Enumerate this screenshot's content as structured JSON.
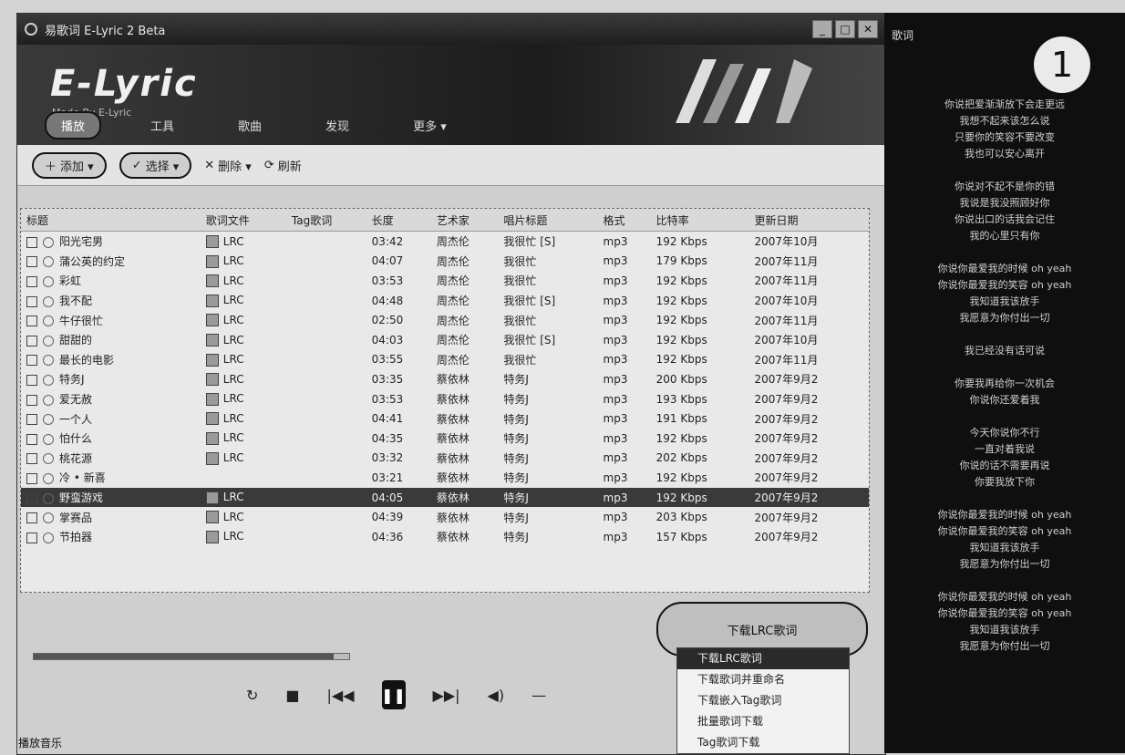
{
  "window": {
    "title": "易歌词 E-Lyric 2 Beta",
    "buttons": [
      "_",
      "□",
      "✕"
    ]
  },
  "banner": {
    "logo": "E-Lyric",
    "subtitle": "Made By E-Lyric"
  },
  "tabs": [
    {
      "label": "播放"
    },
    {
      "label": "工具"
    },
    {
      "label": "歌曲"
    },
    {
      "label": "发现"
    },
    {
      "label": "更多 ▾"
    }
  ],
  "toolbar": {
    "add": "添加 ▾",
    "select": "选择 ▾",
    "delete": "删除 ▾",
    "refresh": "刷新"
  },
  "table": {
    "columns": [
      "标题",
      "歌词文件",
      "Tag歌词",
      "长度",
      "艺术家",
      "唱片标题",
      "格式",
      "比特率",
      "更新日期"
    ],
    "rows": [
      [
        "阳光宅男",
        "LRC",
        "",
        "03:42",
        "周杰伦",
        "我很忙 [S]",
        "mp3",
        "192 Kbps",
        "2007年10月"
      ],
      [
        "蒲公英的约定",
        "LRC",
        "",
        "04:07",
        "周杰伦",
        "我很忙",
        "mp3",
        "179 Kbps",
        "2007年11月"
      ],
      [
        "彩虹",
        "LRC",
        "",
        "03:53",
        "周杰伦",
        "我很忙",
        "mp3",
        "192 Kbps",
        "2007年11月"
      ],
      [
        "我不配",
        "LRC",
        "",
        "04:48",
        "周杰伦",
        "我很忙 [S]",
        "mp3",
        "192 Kbps",
        "2007年10月"
      ],
      [
        "牛仔很忙",
        "LRC",
        "",
        "02:50",
        "周杰伦",
        "我很忙",
        "mp3",
        "192 Kbps",
        "2007年11月"
      ],
      [
        "甜甜的",
        "LRC",
        "",
        "04:03",
        "周杰伦",
        "我很忙 [S]",
        "mp3",
        "192 Kbps",
        "2007年10月"
      ],
      [
        "最长的电影",
        "LRC",
        "",
        "03:55",
        "周杰伦",
        "我很忙",
        "mp3",
        "192 Kbps",
        "2007年11月"
      ],
      [
        "特务J",
        "LRC",
        "",
        "03:35",
        "蔡依林",
        "特务J",
        "mp3",
        "200 Kbps",
        "2007年9月2"
      ],
      [
        "爱无赦",
        "LRC",
        "",
        "03:53",
        "蔡依林",
        "特务J",
        "mp3",
        "193 Kbps",
        "2007年9月2"
      ],
      [
        "一个人",
        "LRC",
        "",
        "04:41",
        "蔡依林",
        "特务J",
        "mp3",
        "191 Kbps",
        "2007年9月2"
      ],
      [
        "怕什么",
        "LRC",
        "",
        "04:35",
        "蔡依林",
        "特务J",
        "mp3",
        "192 Kbps",
        "2007年9月2"
      ],
      [
        "桃花源",
        "LRC",
        "",
        "03:32",
        "蔡依林",
        "特务J",
        "mp3",
        "202 Kbps",
        "2007年9月2"
      ],
      [
        "冷 • 新喜",
        "",
        "",
        "03:21",
        "蔡依林",
        "特务J",
        "mp3",
        "192 Kbps",
        "2007年9月2"
      ],
      [
        "野蛮游戏",
        "LRC",
        "",
        "04:05",
        "蔡依林",
        "特务J",
        "mp3",
        "192 Kbps",
        "2007年9月2"
      ],
      [
        "掌赛品",
        "LRC",
        "",
        "04:39",
        "蔡依林",
        "特务J",
        "mp3",
        "203 Kbps",
        "2007年9月2"
      ],
      [
        "节拍器",
        "LRC",
        "",
        "04:36",
        "蔡依林",
        "特务J",
        "mp3",
        "157 Kbps",
        "2007年9月2"
      ]
    ],
    "selected_row": 13
  },
  "player": {
    "progress": 0.95,
    "controls": [
      "↻",
      "■",
      "|◀◀",
      "❚❚",
      "▶▶|",
      "◀)",
      "—"
    ]
  },
  "status_text": "播放音乐",
  "download": {
    "button": "下载LRC歌词",
    "menu": [
      "下载LRC歌词",
      "下载歌词并重命名",
      "下载嵌入Tag歌词",
      "批量歌词下载",
      "Tag歌词下载"
    ],
    "highlighted": 0
  },
  "lyrics_panel": {
    "title": "歌词",
    "badge": "1",
    "lines": [
      "你说把爱渐渐放下会走更远",
      "我想不起来该怎么说",
      "只要你的笑容不要改变",
      "我也可以安心离开",
      "",
      "你说对不起不是你的错",
      "我说是我没照顾好你",
      "你说出口的话我会记住",
      "我的心里只有你",
      "",
      "你说你最爱我的时候 oh yeah",
      "你说你最爱我的笑容 oh yeah",
      "我知道我该放手",
      "我愿意为你付出一切",
      "",
      "我已经没有话可说",
      "",
      "你要我再给你一次机会",
      "你说你还爱着我",
      "",
      "今天你说你不行",
      "一直对着我说",
      "你说的话不需要再说",
      "你要我放下你",
      "",
      "你说你最爱我的时候 oh yeah",
      "你说你最爱我的笑容 oh yeah",
      "我知道我该放手",
      "我愿意为你付出一切",
      "",
      "你说你最爱我的时候 oh yeah",
      "你说你最爱我的笑容 oh yeah",
      "我知道我该放手",
      "我愿意为你付出一切"
    ]
  }
}
